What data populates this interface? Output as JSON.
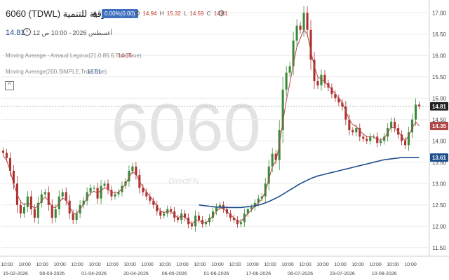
{
  "header": {
    "symbol_title": "6060 (TDWL) الشرقية للتنمية",
    "change_badge": "0.00%(0.00)",
    "ohlc": {
      "o_label": "O",
      "o": "14.94",
      "h_label": "H",
      "h": "15.32",
      "l_label": "L",
      "l": "14.59",
      "c_label": "C",
      "c": "14.81"
    },
    "last_price": "14.81",
    "timestamp": "أغسطس 2026 - 10:00 ص 12"
  },
  "indicators": {
    "ma1_label": "Moving Average - Arnaud Legoux(21,0.85,6,True,True)",
    "ma1_value": "14.35",
    "ma2_label": "Moving Average(200,SIMPLE,True,True)",
    "ma2_value": "13.61"
  },
  "watermark": {
    "symbol": "6060",
    "brand": "DirectFN"
  },
  "colors": {
    "up": "#3a8a3a",
    "down": "#b03030",
    "ma1": "#b04848",
    "ma2": "#1f4e8c",
    "badge": "#3f6fbf",
    "price_tag": "#222222"
  },
  "chart_data": {
    "type": "candlestick",
    "y_ticks": [
      11.5,
      12.0,
      12.5,
      13.0,
      13.5,
      14.0,
      14.5,
      15.0,
      15.5,
      16.0,
      16.5,
      17.0
    ],
    "y_tick_labels": [
      "11.50",
      "12.00",
      "12.50",
      "13.00",
      "13.50",
      "14.00",
      "14.50",
      "15.00",
      "15.50",
      "16.00",
      "16.50",
      "17.00"
    ],
    "ylim": [
      11.3,
      17.3
    ],
    "x_count": 120,
    "x_top_labels": [
      "10:00",
      "10:00",
      "10:00",
      "10:00",
      "10:00",
      "10:00",
      "10:00",
      "10:00",
      "10:00",
      "10:00",
      "10:00",
      "10:00",
      "10:00",
      "10:00",
      "10:00",
      "10:00",
      "10:00",
      "10:00",
      "10:00",
      "10:00",
      "10:00",
      "10:00",
      "10:00",
      "10:00"
    ],
    "x_date_labels": [
      {
        "i": 3,
        "label": "15-02-2026"
      },
      {
        "i": 14,
        "label": "08-03-2026"
      },
      {
        "i": 26,
        "label": "01-04-2026"
      },
      {
        "i": 38,
        "label": "20-04-2026"
      },
      {
        "i": 49,
        "label": "06-05-2026"
      },
      {
        "i": 61,
        "label": "01-06-2026"
      },
      {
        "i": 73,
        "label": "17-06-2026"
      },
      {
        "i": 85,
        "label": "06-07-2026"
      },
      {
        "i": 97,
        "label": "23-07-2026"
      },
      {
        "i": 109,
        "label": "10-08-2026"
      }
    ],
    "closes": [
      13.72,
      13.6,
      13.3,
      13.0,
      12.5,
      12.3,
      12.45,
      12.7,
      12.4,
      12.2,
      12.55,
      12.75,
      12.8,
      12.5,
      12.2,
      12.4,
      12.7,
      12.8,
      12.6,
      12.3,
      12.15,
      12.3,
      12.5,
      12.6,
      12.8,
      12.9,
      12.9,
      12.65,
      12.95,
      13.0,
      12.85,
      12.7,
      12.75,
      12.8,
      12.95,
      13.05,
      13.3,
      13.4,
      13.2,
      12.9,
      12.8,
      12.7,
      12.6,
      12.5,
      12.35,
      12.25,
      12.3,
      12.4,
      12.35,
      12.2,
      12.15,
      12.3,
      12.2,
      12.05,
      12.0,
      12.25,
      12.15,
      12.05,
      12.1,
      12.2,
      12.35,
      12.45,
      12.5,
      12.4,
      12.3,
      12.2,
      12.15,
      12.05,
      12.1,
      12.3,
      12.4,
      12.45,
      12.55,
      12.65,
      12.7,
      13.0,
      13.4,
      13.7,
      13.55,
      14.25,
      15.2,
      15.6,
      15.75,
      16.35,
      16.7,
      16.6,
      17.0,
      16.6,
      15.9,
      15.4,
      15.3,
      15.55,
      15.35,
      15.25,
      15.1,
      15.0,
      14.9,
      14.8,
      14.5,
      14.25,
      14.2,
      14.3,
      14.1,
      14.05,
      14.0,
      14.1,
      14.1,
      13.95,
      14.0,
      14.1,
      14.3,
      14.45,
      14.3,
      14.15,
      14.0,
      13.9,
      14.2,
      14.5,
      14.85,
      14.81
    ],
    "ma1": [
      13.65,
      13.55,
      13.3,
      13.0,
      12.75,
      12.58,
      12.5,
      12.55,
      12.5,
      12.42,
      12.48,
      12.6,
      12.68,
      12.6,
      12.45,
      12.44,
      12.55,
      12.66,
      12.62,
      12.46,
      12.3,
      12.3,
      12.4,
      12.52,
      12.66,
      12.78,
      12.82,
      12.78,
      12.84,
      12.9,
      12.88,
      12.8,
      12.78,
      12.8,
      12.88,
      12.98,
      13.15,
      13.28,
      13.22,
      13.05,
      12.92,
      12.8,
      12.7,
      12.6,
      12.47,
      12.36,
      12.32,
      12.35,
      12.34,
      12.27,
      12.2,
      12.24,
      12.22,
      12.12,
      12.05,
      12.14,
      12.14,
      12.09,
      12.09,
      12.14,
      12.25,
      12.35,
      12.43,
      12.41,
      12.35,
      12.27,
      12.2,
      12.12,
      12.12,
      12.2,
      12.3,
      12.38,
      12.47,
      12.56,
      12.63,
      12.82,
      13.1,
      13.4,
      13.52,
      13.9,
      14.45,
      14.95,
      15.35,
      15.8,
      16.2,
      16.4,
      16.6,
      16.5,
      16.1,
      15.75,
      15.5,
      15.45,
      15.38,
      15.3,
      15.2,
      15.1,
      15.0,
      14.9,
      14.7,
      14.5,
      14.38,
      14.34,
      14.24,
      14.16,
      14.1,
      14.1,
      14.1,
      14.03,
      14.02,
      14.06,
      14.2,
      14.32,
      14.3,
      14.22,
      14.1,
      14.0,
      14.12,
      14.3,
      14.45,
      14.35
    ],
    "ma2_start": 56,
    "ma2": [
      12.5,
      12.49,
      12.48,
      12.47,
      12.46,
      12.45,
      12.45,
      12.44,
      12.44,
      12.44,
      12.44,
      12.44,
      12.44,
      12.45,
      12.46,
      12.47,
      12.48,
      12.5,
      12.52,
      12.55,
      12.58,
      12.62,
      12.66,
      12.7,
      12.75,
      12.8,
      12.85,
      12.9,
      12.95,
      13.0,
      13.04,
      13.08,
      13.12,
      13.15,
      13.18,
      13.2,
      13.22,
      13.24,
      13.26,
      13.28,
      13.3,
      13.32,
      13.34,
      13.36,
      13.38,
      13.4,
      13.42,
      13.44,
      13.46,
      13.48,
      13.5,
      13.52,
      13.54,
      13.56,
      13.57,
      13.58,
      13.59,
      13.6,
      13.61,
      13.61,
      13.61,
      13.61,
      13.61,
      13.61
    ],
    "last_price_tag": 14.81,
    "ma1_tag": 14.35,
    "ma2_tag": 13.61
  }
}
